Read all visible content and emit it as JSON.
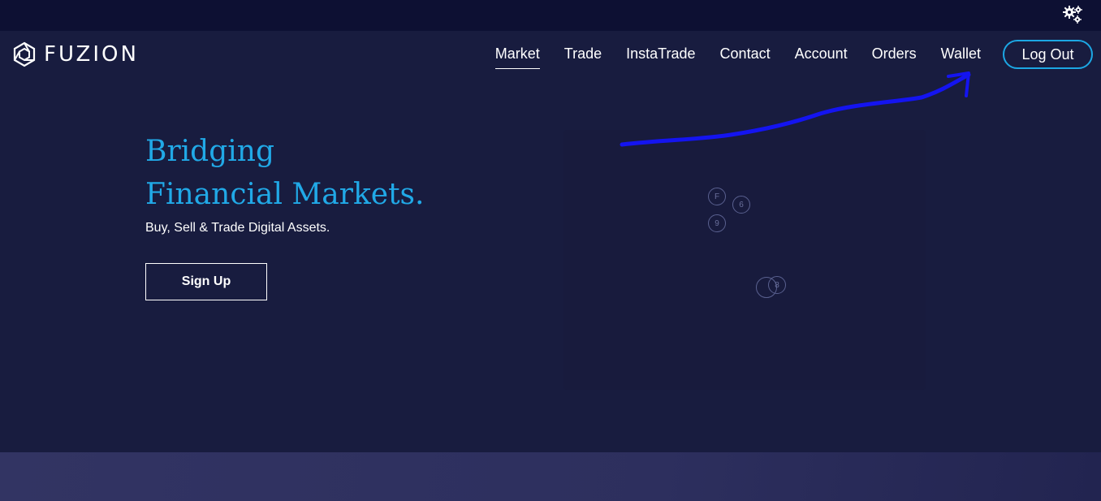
{
  "brand": {
    "name": "FUZION",
    "icon": "fuzion-hex-logo"
  },
  "topbar": {
    "settings_icon": "gears-icon"
  },
  "nav": {
    "items": [
      {
        "label": "Market",
        "active": true
      },
      {
        "label": "Trade"
      },
      {
        "label": "InstaTrade"
      },
      {
        "label": "Contact"
      },
      {
        "label": "Account"
      },
      {
        "label": "Orders"
      },
      {
        "label": "Wallet"
      }
    ],
    "logout_label": "Log Out"
  },
  "hero": {
    "title_line1": "Bridging",
    "title_line2": "Financial Markets.",
    "subtitle": "Buy, Sell & Trade Digital Assets.",
    "signup_label": "Sign Up"
  },
  "graphic": {
    "coins": [
      "F",
      "6",
      "9",
      "",
      "8"
    ]
  },
  "colors": {
    "accent": "#21a9e7",
    "background": "#181c3f",
    "topbar": "#0d1033",
    "annotation": "#1414f0"
  }
}
